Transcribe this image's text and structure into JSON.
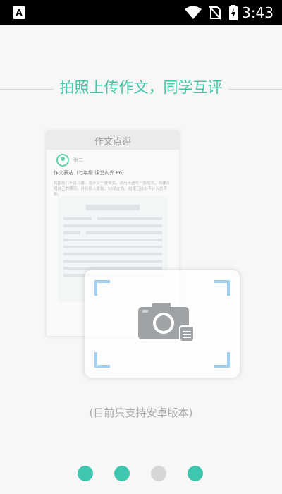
{
  "status_bar": {
    "time": "3:43",
    "app_icon_letter": "A",
    "icons": [
      "wifi-icon",
      "no-sim-icon",
      "battery-charging-icon"
    ]
  },
  "header": {
    "title": "拍照上传作文，同学互评"
  },
  "doc_card": {
    "header_label": "作文点评",
    "username": "张二",
    "subject": "作文表达（七年级 课堂内外 P6）",
    "body_text": "我国前几年曾三番，我乡又一番模式。请用英语写一篇短文，简要介绍自己的情况，并在网上发帖。50词左右。结尾已给出不计入总字数。"
  },
  "footnote": "(目前只支持安卓版本)",
  "pager": {
    "count": 4,
    "active": [
      true,
      true,
      false,
      true
    ]
  },
  "colors": {
    "accent": "#43c5a7",
    "dot_active": "#3fc6ae",
    "dot_inactive": "#d6d6d6",
    "frame_corner": "#9fd0f2",
    "camera": "#9fa3a6"
  }
}
